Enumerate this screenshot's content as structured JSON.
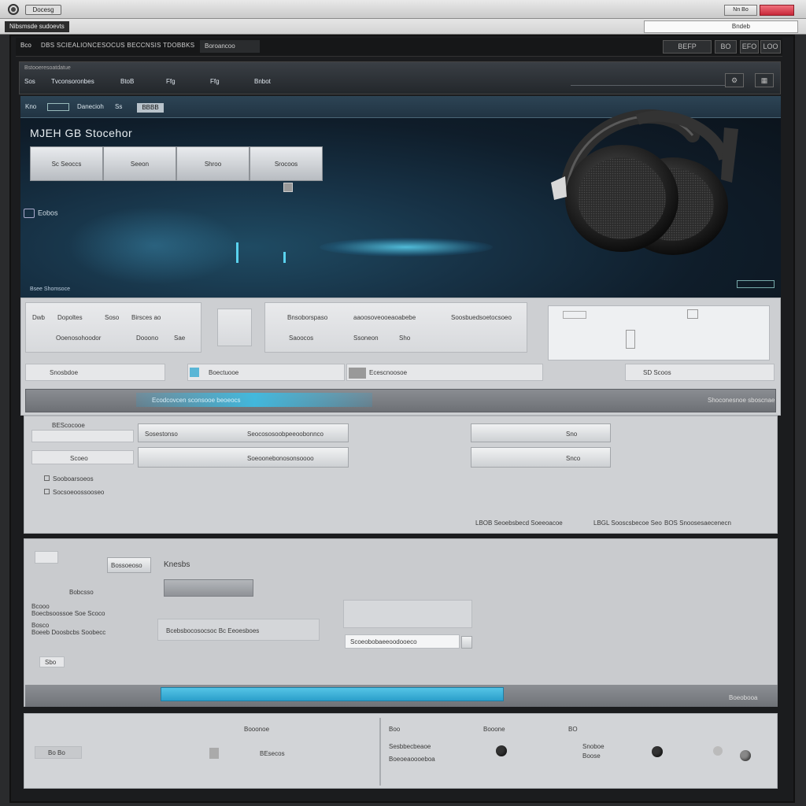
{
  "window": {
    "title_tag": "Docesg",
    "crumb": "Nibsmsde sudoevts",
    "search_value": "Bndeb",
    "button_label": "Nn Bo"
  },
  "appbar": {
    "brand": "Bco",
    "description": "DBS SCIEALIONCESOCUS BECCNSIS TDOBBKS",
    "tag": "Boroancoo",
    "right_buttons": [
      "BEFP",
      "BO",
      "EFO",
      "LOO"
    ]
  },
  "nav": {
    "top_label": "Bstooeresoatdatue",
    "items": [
      "Sos",
      "Tvconsoronbes",
      "BtoB",
      "Ffg",
      "Ffg",
      "Bnbot"
    ],
    "icons": [
      "settings-icon",
      "grid-icon"
    ]
  },
  "hero": {
    "tabs": [
      "Kno",
      "Danecioh",
      "Ss",
      "BBBB"
    ],
    "title": "MJEH GB Stocehor",
    "buttons": [
      "Sc Seoccs",
      "Seeon",
      "Shroo",
      "Srocoos"
    ],
    "mail_label": "Eobos",
    "status_left": "Bsee Shomsoce",
    "headset_alt": "headset"
  },
  "section1": {
    "cards": [
      {
        "labels": [
          "Dwb",
          "Dopoltes",
          "Soso",
          "Birsces ao"
        ],
        "sub": [
          "Ooenosohoodor",
          "Dooono",
          "Sae"
        ]
      },
      {
        "labels": [
          "Bnsoborspaso",
          "aaoosoveooeaoabebe",
          "Soosbuedsoetocsoeo"
        ],
        "sub": [
          "Saoocos",
          "Ssoneon",
          "Sho"
        ]
      }
    ],
    "row_labels": [
      "Snosbdoe",
      "Boectuooe",
      "Ecescnoosoe",
      "SD Scoos"
    ],
    "blue_strip": "Ecodcovcen sconsooe beoeocs",
    "strip_right": "Shoconesnoe sboscnae"
  },
  "section2": {
    "heading": "BEScocooe",
    "rows": [
      {
        "label": "Sosestonso",
        "value": "Seocososoobpeeoobonnco",
        "btn": "Sno"
      },
      {
        "label": "Scoeo",
        "value": "Soeoonebonosonsoooo",
        "btn": "Snco"
      }
    ],
    "checks": [
      "Sooboarsoeos",
      "Socsoeoossooseo"
    ],
    "footer": [
      "LBOB Seoebsbecd Soeeoacoe",
      "LBGL Sooscsbecoe Seo",
      "BOS Snoosesaecenecn"
    ]
  },
  "section3": {
    "heading": "Knesbs",
    "btn1": "Bossoeoso",
    "field_label": "Bobcsso",
    "rows": [
      "Bcooo",
      "Boecbsoossoe Soe Scoco",
      "Bosco",
      "Boeeb Doosbcbs Soobecc"
    ],
    "value": "Bcebsbocosocsoc Bc Eeoesboes",
    "input": "Scoeobobaeeoodooeco",
    "save": "Sbo",
    "progress_percent": 100,
    "progress_label": "Boeobooa"
  },
  "section4": {
    "header_left": "Booonoe",
    "header_right": [
      "Boo",
      "Booone",
      "BO"
    ],
    "left_labels": [
      "Bo Bo",
      "BEsecos"
    ],
    "right_labels": [
      "Sesbbecbeaoe",
      "Boeoeaoooeboa",
      "Snoboe",
      "Boose"
    ]
  }
}
